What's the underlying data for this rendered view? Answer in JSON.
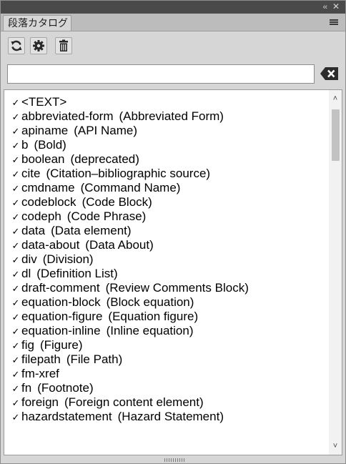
{
  "window": {
    "tab_label": "段落カタログ",
    "collapse_glyph": "‹‹",
    "close_glyph": "✕"
  },
  "toolbar": {
    "buttons": [
      {
        "icon": "refresh-icon"
      },
      {
        "icon": "gear-icon"
      },
      {
        "icon": "trash-icon"
      }
    ]
  },
  "search": {
    "value": "",
    "placeholder": ""
  },
  "list": {
    "check_glyph": "✓",
    "items": [
      {
        "name": "<TEXT>",
        "desc": ""
      },
      {
        "name": "abbreviated-form",
        "desc": "(Abbreviated Form)"
      },
      {
        "name": "apiname",
        "desc": "(API Name)"
      },
      {
        "name": "b",
        "desc": "(Bold)"
      },
      {
        "name": "boolean",
        "desc": "(deprecated)"
      },
      {
        "name": "cite",
        "desc": "(Citation–bibliographic source)"
      },
      {
        "name": "cmdname",
        "desc": "(Command Name)"
      },
      {
        "name": "codeblock",
        "desc": "(Code Block)"
      },
      {
        "name": "codeph",
        "desc": "(Code Phrase)"
      },
      {
        "name": "data",
        "desc": "(Data element)"
      },
      {
        "name": "data-about",
        "desc": "(Data About)"
      },
      {
        "name": "div",
        "desc": "(Division)"
      },
      {
        "name": "dl",
        "desc": "(Definition List)"
      },
      {
        "name": "draft-comment",
        "desc": "(Review Comments Block)"
      },
      {
        "name": "equation-block",
        "desc": "(Block equation)"
      },
      {
        "name": "equation-figure",
        "desc": "(Equation figure)"
      },
      {
        "name": "equation-inline",
        "desc": "(Inline equation)"
      },
      {
        "name": "fig",
        "desc": "(Figure)"
      },
      {
        "name": "filepath",
        "desc": "(File Path)"
      },
      {
        "name": "fm-xref",
        "desc": ""
      },
      {
        "name": "fn",
        "desc": "(Footnote)"
      },
      {
        "name": "foreign",
        "desc": "(Foreign content element)"
      },
      {
        "name": "hazardstatement",
        "desc": "(Hazard Statement)"
      }
    ]
  },
  "scrollbar": {
    "up_glyph": "˄",
    "down_glyph": "˅"
  }
}
